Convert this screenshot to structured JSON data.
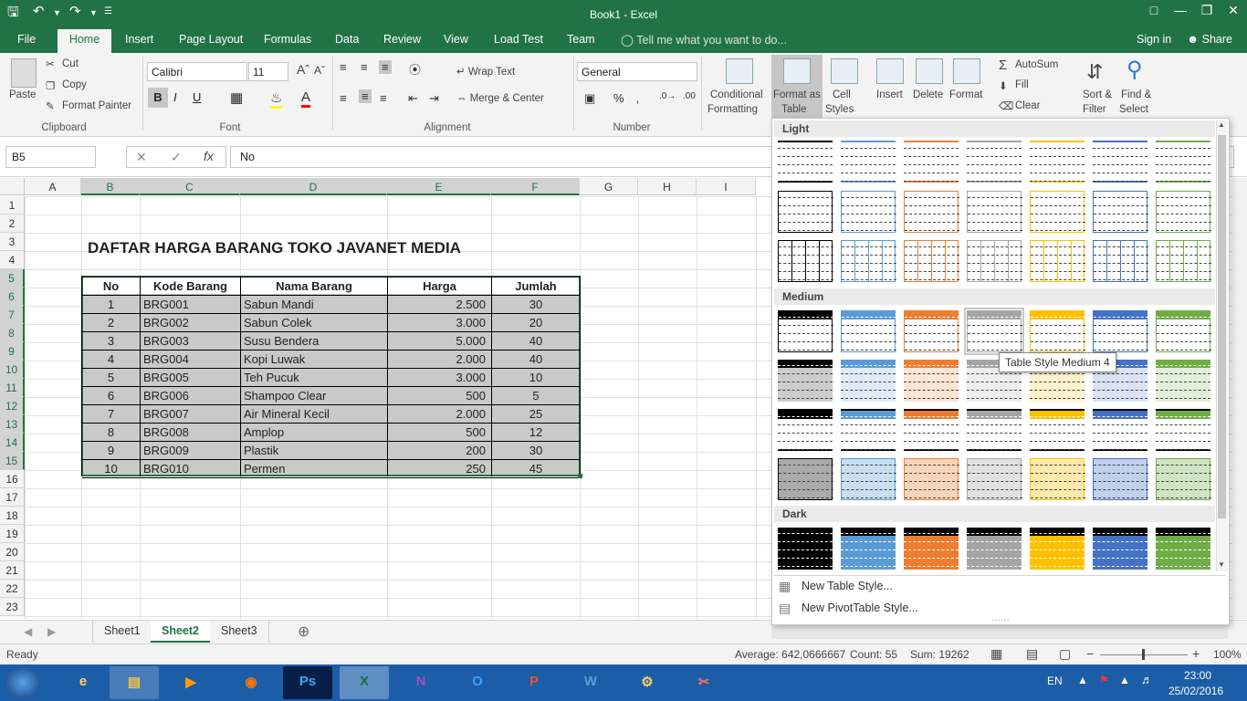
{
  "window": {
    "title": "Book1 - Excel"
  },
  "tabs": [
    "File",
    "Home",
    "Insert",
    "Page Layout",
    "Formulas",
    "Data",
    "Review",
    "View",
    "Load Test",
    "Team"
  ],
  "tellme": "Tell me what you want to do...",
  "signin": "Sign in",
  "share": "Share",
  "clipboard": {
    "paste": "Paste",
    "cut": "Cut",
    "copy": "Copy",
    "format_painter": "Format Painter",
    "label": "Clipboard"
  },
  "font": {
    "name": "Calibri",
    "size": "11",
    "label": "Font",
    "bold": "B",
    "italic": "I",
    "underline": "U"
  },
  "alignment": {
    "wrap": "Wrap Text",
    "merge": "Merge & Center",
    "label": "Alignment"
  },
  "number": {
    "format": "General",
    "label": "Number",
    "percent": "%"
  },
  "styles": {
    "conditional": "Conditional",
    "conditional2": "Formatting",
    "format_as": "Format as",
    "format_as2": "Table",
    "cell": "Cell",
    "cell2": "Styles"
  },
  "cells": {
    "insert": "Insert",
    "delete": "Delete",
    "format": "Format"
  },
  "editing": {
    "autosum": "AutoSum",
    "fill": "Fill",
    "clear": "Clear",
    "sort": "Sort &",
    "sort2": "Filter",
    "find": "Find &",
    "find2": "Select"
  },
  "formula_bar": {
    "name_box": "B5",
    "fx": "fx",
    "value": "No"
  },
  "columns": [
    "A",
    "B",
    "C",
    "D",
    "E",
    "F",
    "G",
    "H",
    "I"
  ],
  "rows": [
    "1",
    "2",
    "3",
    "4",
    "5",
    "6",
    "7",
    "8",
    "9",
    "10",
    "11",
    "12",
    "13",
    "14",
    "15",
    "16",
    "17",
    "18",
    "19",
    "20",
    "21",
    "22",
    "23"
  ],
  "sheet_title": "DAFTAR HARGA BARANG TOKO JAVANET MEDIA",
  "table": {
    "headers": [
      "No",
      "Kode Barang",
      "Nama Barang",
      "Harga",
      "Jumlah"
    ],
    "rows": [
      [
        "1",
        "BRG001",
        "Sabun Mandi",
        "2.500",
        "30"
      ],
      [
        "2",
        "BRG002",
        "Sabun Colek",
        "3.000",
        "20"
      ],
      [
        "3",
        "BRG003",
        "Susu Bendera",
        "5.000",
        "40"
      ],
      [
        "4",
        "BRG004",
        "Kopi Luwak",
        "2.000",
        "40"
      ],
      [
        "5",
        "BRG005",
        "Teh Pucuk",
        "3.000",
        "10"
      ],
      [
        "6",
        "BRG006",
        "Shampoo Clear",
        "500",
        "5"
      ],
      [
        "7",
        "BRG007",
        "Air Mineral Kecil",
        "2.000",
        "25"
      ],
      [
        "8",
        "BRG008",
        "Amplop",
        "500",
        "12"
      ],
      [
        "9",
        "BRG009",
        "Plastik",
        "200",
        "30"
      ],
      [
        "10",
        "BRG010",
        "Permen",
        "250",
        "45"
      ]
    ]
  },
  "gallery": {
    "light": "Light",
    "medium": "Medium",
    "dark": "Dark",
    "tooltip": "Table Style Medium 4",
    "new_table_style": "New Table Style...",
    "new_pivot_style": "New PivotTable Style...",
    "colors": [
      "#333333",
      "#5b9bd5",
      "#ed7d31",
      "#a5a5a5",
      "#ffc000",
      "#4472c4",
      "#70ad47"
    ]
  },
  "sheets": [
    "Sheet1",
    "Sheet2",
    "Sheet3"
  ],
  "active_sheet": "Sheet2",
  "status": {
    "ready": "Ready",
    "average": "Average: 642,0666667",
    "count": "Count: 55",
    "sum": "Sum: 19262",
    "zoom": "100%"
  },
  "taskbar": {
    "lang": "EN",
    "time": "23:00",
    "date": "25/02/2016"
  }
}
